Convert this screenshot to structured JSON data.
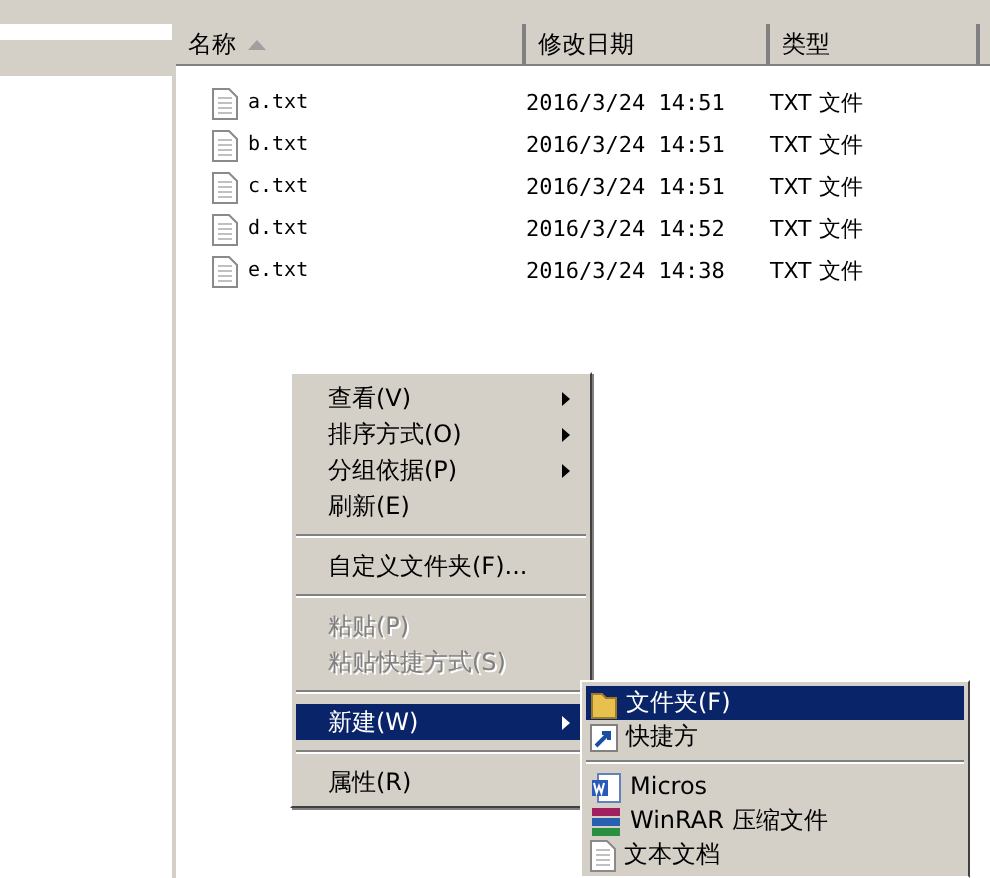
{
  "columns": [
    {
      "label": "名称",
      "sorted": true
    },
    {
      "label": "修改日期",
      "sorted": false
    },
    {
      "label": "类型",
      "sorted": false
    }
  ],
  "files": [
    {
      "name": "a.txt",
      "modified": "2016/3/24 14:51",
      "type": "TXT 文件"
    },
    {
      "name": "b.txt",
      "modified": "2016/3/24 14:51",
      "type": "TXT 文件"
    },
    {
      "name": "c.txt",
      "modified": "2016/3/24 14:51",
      "type": "TXT 文件"
    },
    {
      "name": "d.txt",
      "modified": "2016/3/24 14:52",
      "type": "TXT 文件"
    },
    {
      "name": "e.txt",
      "modified": "2016/3/24 14:38",
      "type": "TXT 文件"
    }
  ],
  "context_menu": [
    {
      "kind": "item",
      "label": "查看(V)",
      "submenu": true,
      "disabled": false,
      "selected": false
    },
    {
      "kind": "item",
      "label": "排序方式(O)",
      "submenu": true,
      "disabled": false,
      "selected": false
    },
    {
      "kind": "item",
      "label": "分组依据(P)",
      "submenu": true,
      "disabled": false,
      "selected": false
    },
    {
      "kind": "item",
      "label": "刷新(E)",
      "submenu": false,
      "disabled": false,
      "selected": false
    },
    {
      "kind": "separator"
    },
    {
      "kind": "item",
      "label": "自定义文件夹(F)...",
      "submenu": false,
      "disabled": false,
      "selected": false
    },
    {
      "kind": "separator"
    },
    {
      "kind": "item",
      "label": "粘贴(P)",
      "submenu": false,
      "disabled": true,
      "selected": false
    },
    {
      "kind": "item",
      "label": "粘贴快捷方式(S)",
      "submenu": false,
      "disabled": true,
      "selected": false
    },
    {
      "kind": "separator"
    },
    {
      "kind": "item",
      "label": "新建(W)",
      "submenu": true,
      "disabled": false,
      "selected": true
    },
    {
      "kind": "separator"
    },
    {
      "kind": "item",
      "label": "属性(R)",
      "submenu": false,
      "disabled": false,
      "selected": false
    }
  ],
  "new_submenu": [
    {
      "kind": "folder",
      "label": "文件夹(F)",
      "selected": true
    },
    {
      "kind": "shortcut",
      "label": "快捷方",
      "selected": false
    },
    {
      "kind": "separator"
    },
    {
      "kind": "word",
      "label": "Micros",
      "selected": false
    },
    {
      "kind": "winrar",
      "label": "WinRAR 压缩文件",
      "selected": false
    },
    {
      "kind": "text",
      "label": "文本文档",
      "selected": false
    }
  ]
}
